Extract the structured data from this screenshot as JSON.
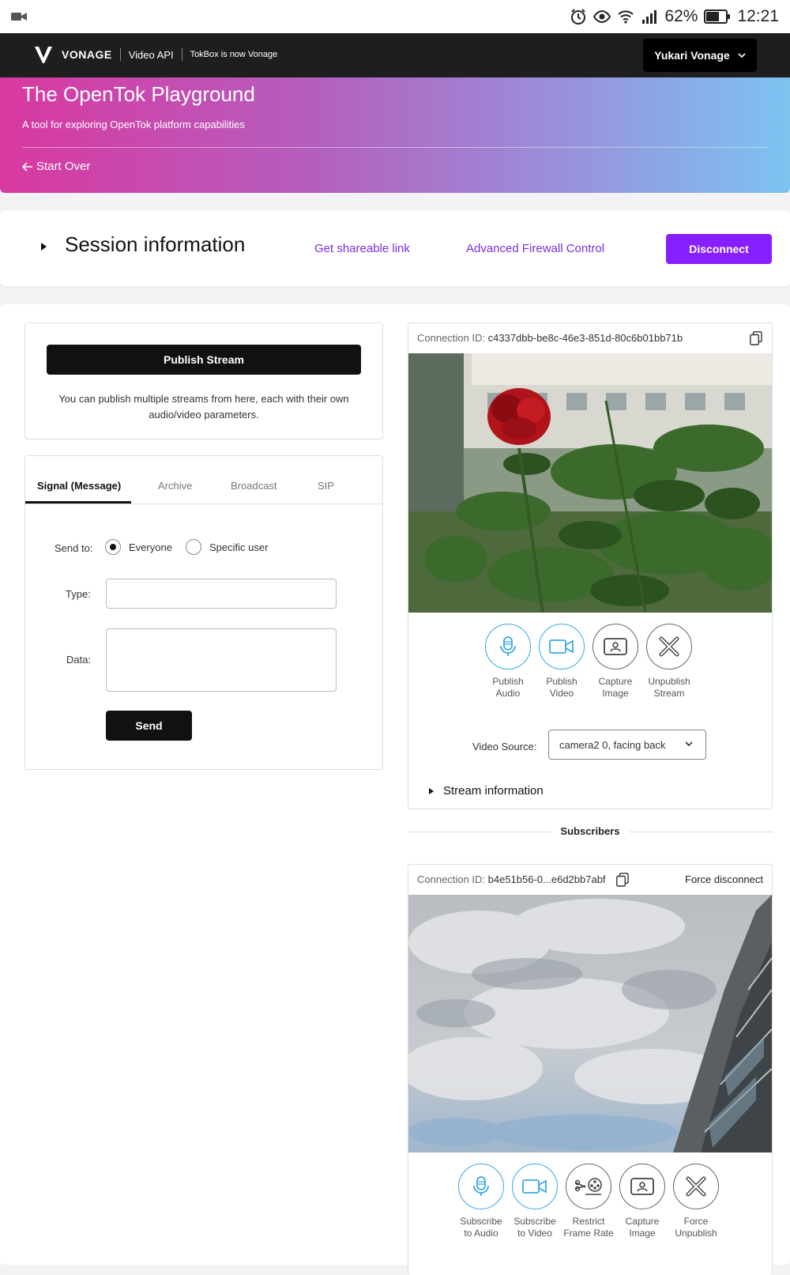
{
  "status_bar": {
    "battery": "62%",
    "time": "12:21"
  },
  "nav": {
    "brand": "VONAGE",
    "product": "Video API",
    "tagline": "TokBox is now Vonage",
    "user_menu": "Yukari Vonage"
  },
  "hero": {
    "title": "The OpenTok Playground",
    "subtitle": "A tool for exploring OpenTok platform capabilities",
    "start_over": "Start Over"
  },
  "session": {
    "title": "Session information",
    "share_link": "Get shareable link",
    "firewall_link": "Advanced Firewall Control",
    "disconnect": "Disconnect"
  },
  "publish": {
    "button": "Publish Stream",
    "note": "You can publish multiple streams from here, each with their own audio/video parameters."
  },
  "signal": {
    "tabs": [
      "Signal (Message)",
      "Archive",
      "Broadcast",
      "SIP"
    ],
    "send_to_label": "Send to:",
    "radio_everyone": "Everyone",
    "radio_specific": "Specific user",
    "type_label": "Type:",
    "type_value": "",
    "data_label": "Data:",
    "data_value": "",
    "send": "Send"
  },
  "publisher": {
    "connection_label": "Connection ID:",
    "connection_id": "c4337dbb-be8c-46e3-851d-80c6b01bb71b",
    "controls": [
      {
        "label_1": "Publish",
        "label_2": "Audio",
        "icon": "microphone-icon"
      },
      {
        "label_1": "Publish",
        "label_2": "Video",
        "icon": "video-camera-icon"
      },
      {
        "label_1": "Capture",
        "label_2": "Image",
        "icon": "capture-image-icon"
      },
      {
        "label_1": "Unpublish",
        "label_2": "Stream",
        "icon": "unpublish-x-icon"
      }
    ],
    "video_source_label": "Video Source:",
    "video_source_value": "camera2 0, facing back",
    "stream_info": "Stream information"
  },
  "subscribers": {
    "header": "Subscribers",
    "connection_label": "Connection ID:",
    "connection_id": "b4e51b56-0...e6d2bb7abf",
    "force_disconnect": "Force disconnect",
    "controls": [
      {
        "label_1": "Subscribe",
        "label_2": "to Audio",
        "icon": "microphone-icon"
      },
      {
        "label_1": "Subscribe",
        "label_2": "to Video",
        "icon": "video-camera-icon"
      },
      {
        "label_1": "Restrict",
        "label_2": "Frame Rate",
        "icon": "film-reel-icon"
      },
      {
        "label_1": "Capture",
        "label_2": "Image",
        "icon": "capture-image-icon"
      },
      {
        "label_1": "Force",
        "label_2": "Unpublish",
        "icon": "force-unpublish-x-icon"
      }
    ]
  },
  "colors": {
    "accent_purple": "#871fff",
    "link_purple": "#7a2ee0",
    "control_blue": "#3aa7e8"
  }
}
